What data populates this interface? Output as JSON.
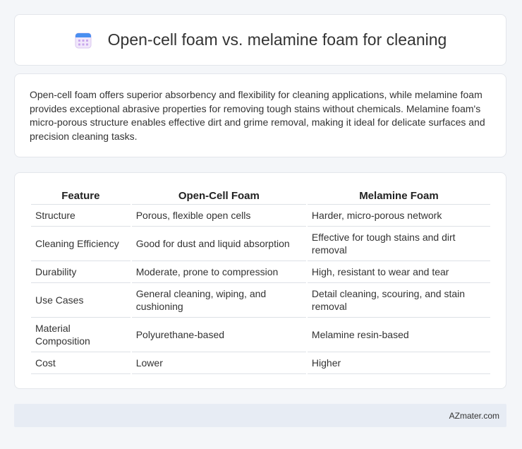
{
  "header": {
    "title": "Open-cell foam vs. melamine foam for cleaning",
    "icon": "calendar-icon"
  },
  "description": "Open-cell foam offers superior absorbency and flexibility for cleaning applications, while melamine foam provides exceptional abrasive properties for removing tough stains without chemicals. Melamine foam's micro-porous structure enables effective dirt and grime removal, making it ideal for delicate surfaces and precision cleaning tasks.",
  "table": {
    "headers": [
      "Feature",
      "Open-Cell Foam",
      "Melamine Foam"
    ],
    "rows": [
      [
        "Structure",
        "Porous, flexible open cells",
        "Harder, micro-porous network"
      ],
      [
        "Cleaning Efficiency",
        "Good for dust and liquid absorption",
        "Effective for tough stains and dirt removal"
      ],
      [
        "Durability",
        "Moderate, prone to compression",
        "High, resistant to wear and tear"
      ],
      [
        "Use Cases",
        "General cleaning, wiping, and cushioning",
        "Detail cleaning, scouring, and stain removal"
      ],
      [
        "Material Composition",
        "Polyurethane-based",
        "Melamine resin-based"
      ],
      [
        "Cost",
        "Lower",
        "Higher"
      ]
    ]
  },
  "footer": {
    "brand": "AZmater.com"
  },
  "colors": {
    "background": "#f4f6f9",
    "card": "#ffffff",
    "footer": "#e7ecf4",
    "icon_accent": "#4a8ff0"
  }
}
